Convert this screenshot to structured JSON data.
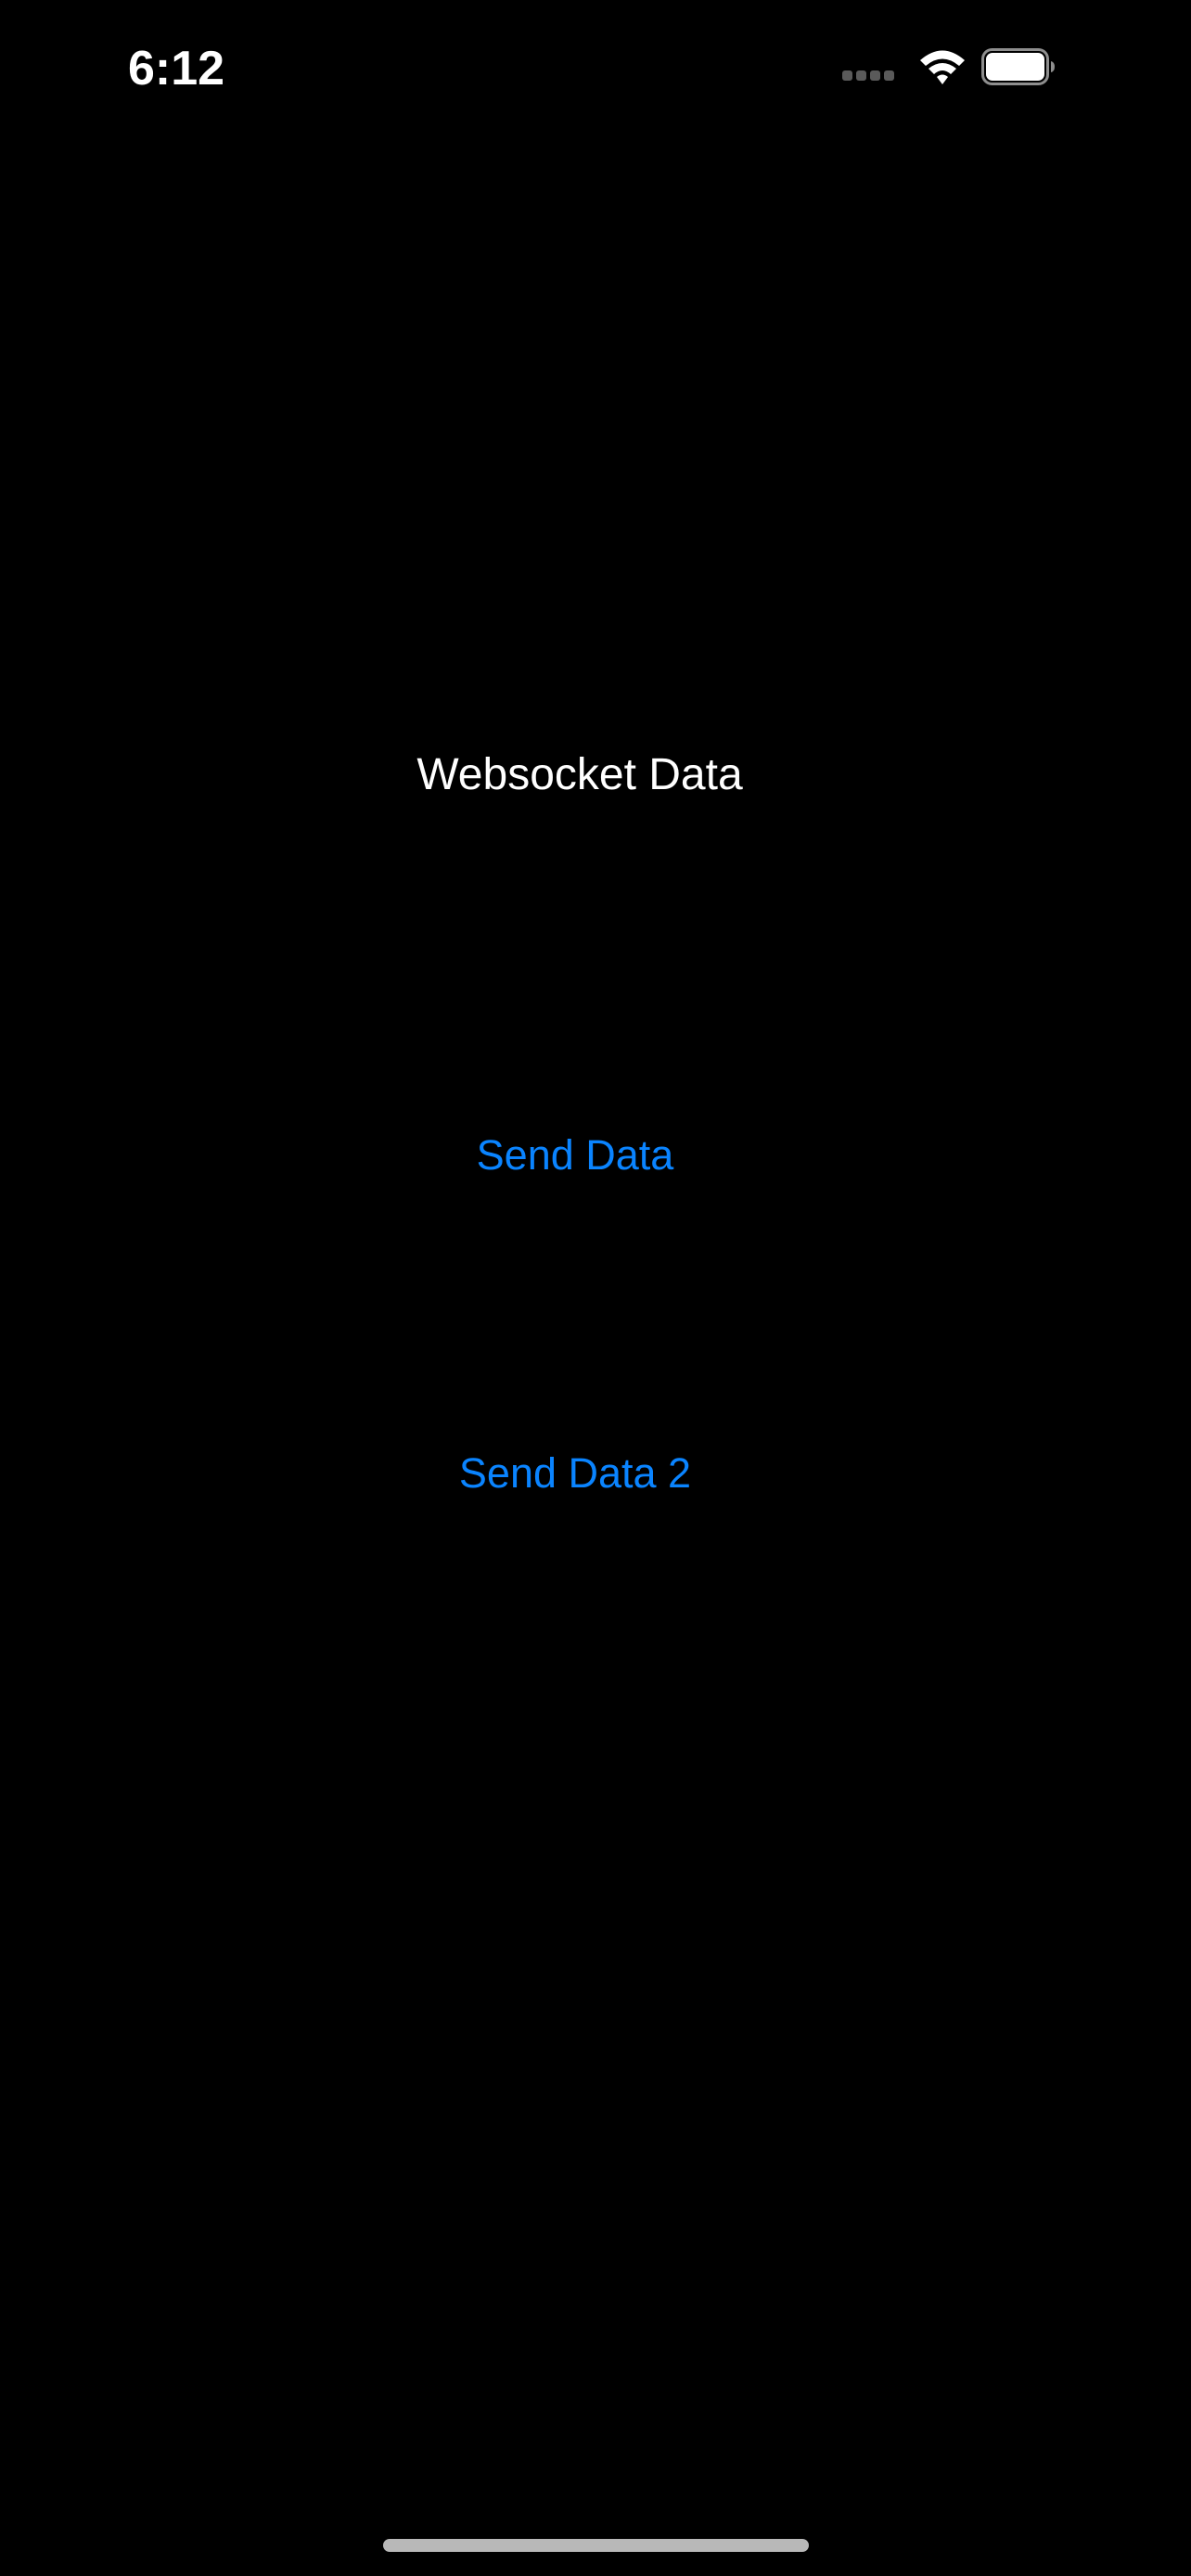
{
  "status_bar": {
    "time": "6:12",
    "icons": [
      "signal-icon",
      "wifi-icon",
      "battery-icon"
    ],
    "battery_level": 1.0
  },
  "main": {
    "title": "Websocket Data",
    "buttons": [
      {
        "label": "Send Data"
      },
      {
        "label": "Send Data 2"
      }
    ]
  },
  "colors": {
    "background": "#000000",
    "text": "#ffffff",
    "accent": "#0a84ff"
  }
}
